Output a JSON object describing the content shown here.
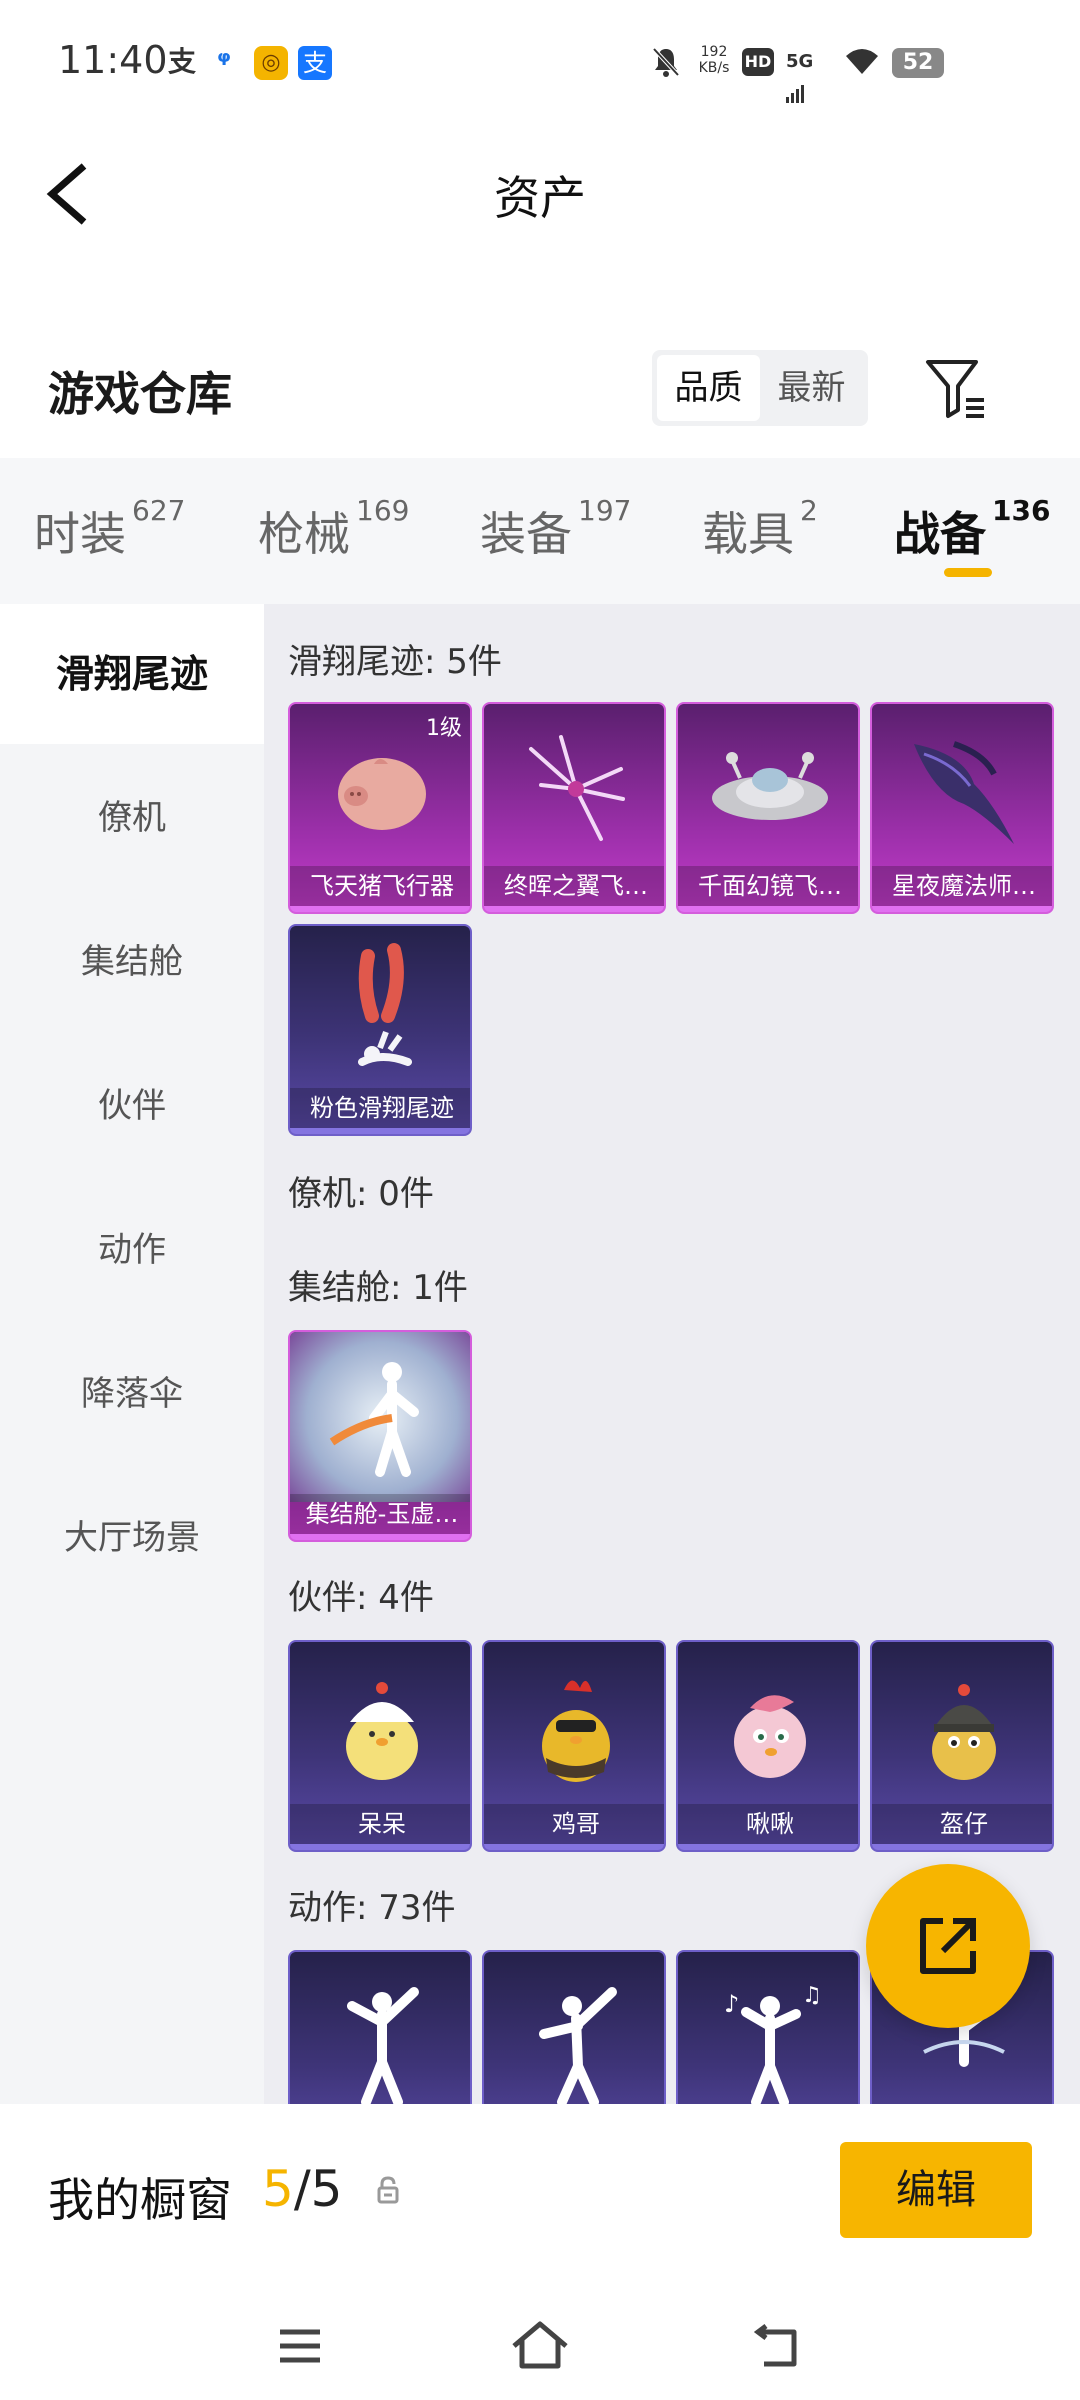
{
  "status_bar": {
    "time": "11:40",
    "app_icons": [
      "支",
      "ᵠ",
      "◎",
      "支"
    ],
    "net_speed_value": "192",
    "net_speed_unit": "KB/s",
    "hd": "HD",
    "signal": "5G",
    "battery": "52"
  },
  "header": {
    "title": "资产"
  },
  "warehouse": {
    "title": "游戏仓库",
    "sort_options": [
      "品质",
      "最新"
    ],
    "active_sort": "品质"
  },
  "tabs": [
    {
      "label": "时装",
      "count": "627"
    },
    {
      "label": "枪械",
      "count": "169"
    },
    {
      "label": "装备",
      "count": "197"
    },
    {
      "label": "载具",
      "count": "2"
    },
    {
      "label": "战备",
      "count": "136"
    }
  ],
  "active_tab": "战备",
  "sidebar": [
    {
      "label": "滑翔尾迹"
    },
    {
      "label": "僚机"
    },
    {
      "label": "集结舱"
    },
    {
      "label": "伙伴"
    },
    {
      "label": "动作"
    },
    {
      "label": "降落伞"
    },
    {
      "label": "大厅场景"
    }
  ],
  "active_sidebar": "滑翔尾迹",
  "sections": {
    "trail": {
      "title": "滑翔尾迹: 5件",
      "items": [
        {
          "name": "飞天猪飞行器",
          "level": "1级"
        },
        {
          "name": "终晖之翼飞…"
        },
        {
          "name": "千面幻镜飞…"
        },
        {
          "name": "星夜魔法师…"
        },
        {
          "name": "粉色滑翔尾迹"
        }
      ]
    },
    "wingman": {
      "title": "僚机: 0件"
    },
    "pod": {
      "title": "集结舱: 1件",
      "items": [
        {
          "name": "集结舱-玉虚…"
        }
      ]
    },
    "partner": {
      "title": "伙伴: 4件",
      "items": [
        {
          "name": "呆呆"
        },
        {
          "name": "鸡哥"
        },
        {
          "name": "啾啾"
        },
        {
          "name": "盔仔"
        }
      ]
    },
    "emote": {
      "title": "动作: 73件"
    }
  },
  "showcase": {
    "title": "我的橱窗",
    "current": "5",
    "separator": "/",
    "max": "5",
    "edit_label": "编辑"
  },
  "colors": {
    "accent": "#f7b500",
    "legendary_purple": "#c43ccc",
    "epic_blue": "#5a4aa8"
  }
}
